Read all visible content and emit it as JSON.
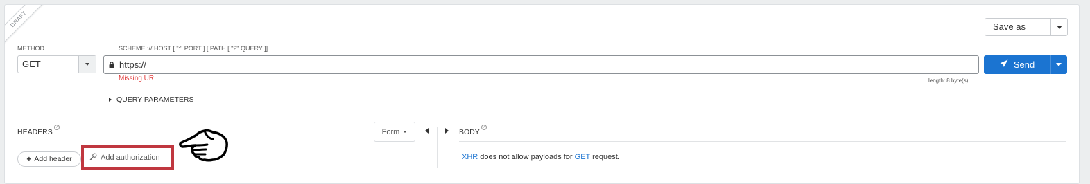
{
  "ribbon": {
    "label": "DRAFT"
  },
  "save_as": {
    "label": "Save as"
  },
  "method": {
    "label": "METHOD",
    "value": "GET"
  },
  "uri": {
    "label": "SCHEME :// HOST [ \":\" PORT ] [ PATH [ \"?\" QUERY ]]",
    "value": "https://",
    "error": "Missing URI",
    "length": "length: 8 byte(s)"
  },
  "send": {
    "label": "Send"
  },
  "query_params": {
    "label": "QUERY PARAMETERS"
  },
  "headers": {
    "title": "HEADERS",
    "form_label": "Form",
    "add_header_label": "Add header",
    "add_auth_label": "Add authorization"
  },
  "body": {
    "title": "BODY",
    "note_xhr": "XHR",
    "note_middle": " does not allow payloads for ",
    "note_method": "GET",
    "note_end": " request."
  },
  "icons": {
    "lock": "lock-icon",
    "send": "paper-plane-icon",
    "key": "key-icon",
    "hand": "pointing-hand-icon"
  },
  "colors": {
    "accent": "#1b74d1",
    "error": "#e03b3b",
    "highlight": "#c0373f"
  }
}
